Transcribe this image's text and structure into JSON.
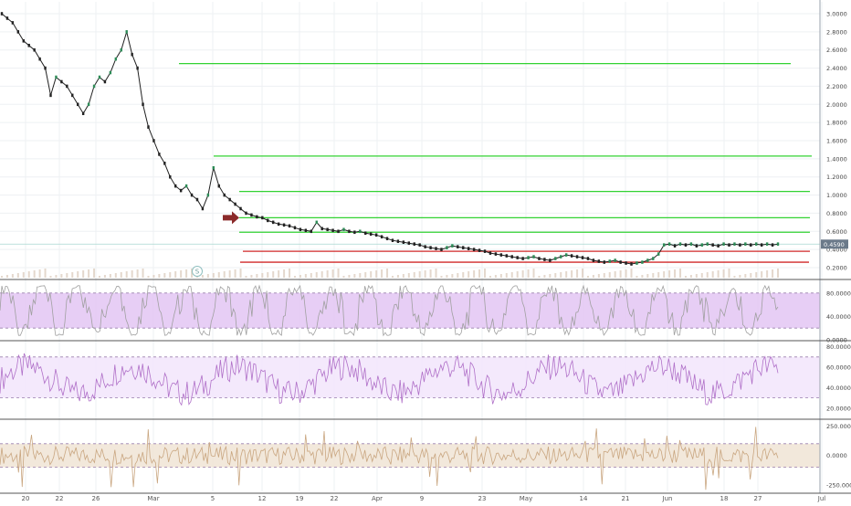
{
  "chart_data": {
    "type": "line",
    "panels": [
      {
        "name": "price",
        "scale": "linear",
        "y_ticks": [
          "3.0000",
          "2.8000",
          "2.6000",
          "2.4000",
          "2.2000",
          "2.0000",
          "1.8000",
          "1.6000",
          "1.4000",
          "1.2000",
          "1.0000",
          "0.8000",
          "0.6000",
          "0.4000",
          "0.2000"
        ],
        "ylim": [
          0.1,
          3.1
        ],
        "last_price": "0.4590",
        "series": [
          {
            "x": [
              0,
              1,
              2,
              3,
              4,
              5,
              6,
              7,
              8,
              9,
              10,
              11,
              12,
              13,
              14,
              15,
              16,
              17,
              18,
              19,
              20,
              21,
              22,
              23,
              24,
              25,
              26,
              27,
              28,
              29,
              30,
              31,
              32,
              33,
              34,
              35,
              36,
              37,
              38,
              39,
              40,
              41,
              42,
              43,
              44,
              45,
              46,
              47,
              48,
              49,
              50,
              51,
              52,
              53,
              54,
              55,
              56,
              57,
              58,
              59,
              60,
              61,
              62,
              63,
              64,
              65,
              66,
              67,
              68,
              69,
              70,
              71,
              72,
              73,
              74,
              75,
              76,
              77,
              78,
              79,
              80,
              81,
              82,
              83,
              84,
              85,
              86,
              87,
              88,
              89,
              90,
              91,
              92,
              93,
              94,
              95,
              96,
              97,
              98,
              99,
              100,
              101,
              102,
              103,
              104,
              105,
              106,
              107,
              108,
              109,
              110,
              111,
              112,
              113,
              114,
              115,
              116,
              117,
              118,
              119,
              120,
              121,
              122,
              123,
              124,
              125,
              126,
              127,
              128,
              129,
              130,
              131,
              132,
              133,
              134,
              135,
              136,
              137,
              138,
              139,
              140,
              141,
              142,
              143
            ],
            "y": [
              3.0,
              2.95,
              2.9,
              2.8,
              2.7,
              2.65,
              2.6,
              2.5,
              2.4,
              2.1,
              2.3,
              2.25,
              2.2,
              2.1,
              2.0,
              1.9,
              2.0,
              2.2,
              2.3,
              2.25,
              2.35,
              2.5,
              2.6,
              2.8,
              2.55,
              2.4,
              2.0,
              1.75,
              1.6,
              1.45,
              1.35,
              1.2,
              1.1,
              1.05,
              1.1,
              1.0,
              0.95,
              0.85,
              1.0,
              1.3,
              1.1,
              1.0,
              0.95,
              0.9,
              0.85,
              0.8,
              0.78,
              0.76,
              0.75,
              0.72,
              0.7,
              0.68,
              0.67,
              0.66,
              0.64,
              0.62,
              0.61,
              0.6,
              0.7,
              0.63,
              0.62,
              0.61,
              0.6,
              0.62,
              0.6,
              0.59,
              0.6,
              0.58,
              0.57,
              0.56,
              0.54,
              0.52,
              0.5,
              0.49,
              0.48,
              0.47,
              0.46,
              0.45,
              0.43,
              0.42,
              0.41,
              0.4,
              0.42,
              0.44,
              0.43,
              0.42,
              0.41,
              0.4,
              0.39,
              0.38,
              0.36,
              0.35,
              0.34,
              0.33,
              0.32,
              0.31,
              0.3,
              0.31,
              0.32,
              0.3,
              0.29,
              0.28,
              0.3,
              0.32,
              0.34,
              0.33,
              0.32,
              0.31,
              0.3,
              0.28,
              0.27,
              0.26,
              0.27,
              0.28,
              0.26,
              0.25,
              0.24,
              0.25,
              0.26,
              0.28,
              0.3,
              0.35,
              0.45,
              0.46,
              0.44,
              0.46,
              0.45,
              0.46,
              0.44,
              0.45,
              0.46,
              0.45,
              0.44,
              0.46,
              0.45,
              0.46,
              0.45,
              0.46,
              0.45,
              0.46,
              0.45,
              0.46,
              0.45,
              0.46
            ]
          }
        ]
      },
      {
        "name": "oscillator-1",
        "y_ticks": [
          "80.0000",
          "40.0000",
          "0.0000"
        ],
        "ylim": [
          0,
          100
        ],
        "band": [
          20,
          80
        ]
      },
      {
        "name": "oscillator-2",
        "y_ticks": [
          "80.0000",
          "60.0000",
          "40.0000",
          "20.0000"
        ],
        "ylim": [
          10,
          85
        ],
        "band": [
          30,
          70
        ]
      },
      {
        "name": "oscillator-3",
        "y_ticks": [
          "250.0000",
          "0.0000",
          "-250.0000"
        ],
        "ylim": [
          -320,
          300
        ],
        "band": [
          -100,
          100
        ]
      }
    ],
    "x_ticks": [
      "20",
      "22",
      "26",
      "Mar",
      "5",
      "12",
      "19",
      "22",
      "Apr",
      "9",
      "23",
      "May",
      "14",
      "21",
      "Jun",
      "18",
      "27",
      "Jul"
    ],
    "horizontal_lines": [
      {
        "color": "#32d232",
        "price": 2.45
      },
      {
        "color": "#32d232",
        "price": 1.43
      },
      {
        "color": "#32d232",
        "price": 1.04
      },
      {
        "color": "#32d232",
        "price": 0.75
      },
      {
        "color": "#32d232",
        "price": 0.59
      },
      {
        "color": "#d02828",
        "price": 0.38
      },
      {
        "color": "#d02828",
        "price": 0.26
      }
    ],
    "annotation_marker": "S",
    "colors": {
      "panel1_fill": "#e3c5f3",
      "panel2_fill": "#f2e5fb",
      "panel3_fill": "#f0e4d5",
      "osc1_line": "#a0a0a0",
      "osc2_line": "#b070c8",
      "osc3_line": "#c9a680",
      "arrow": "#8b2a2a"
    }
  }
}
